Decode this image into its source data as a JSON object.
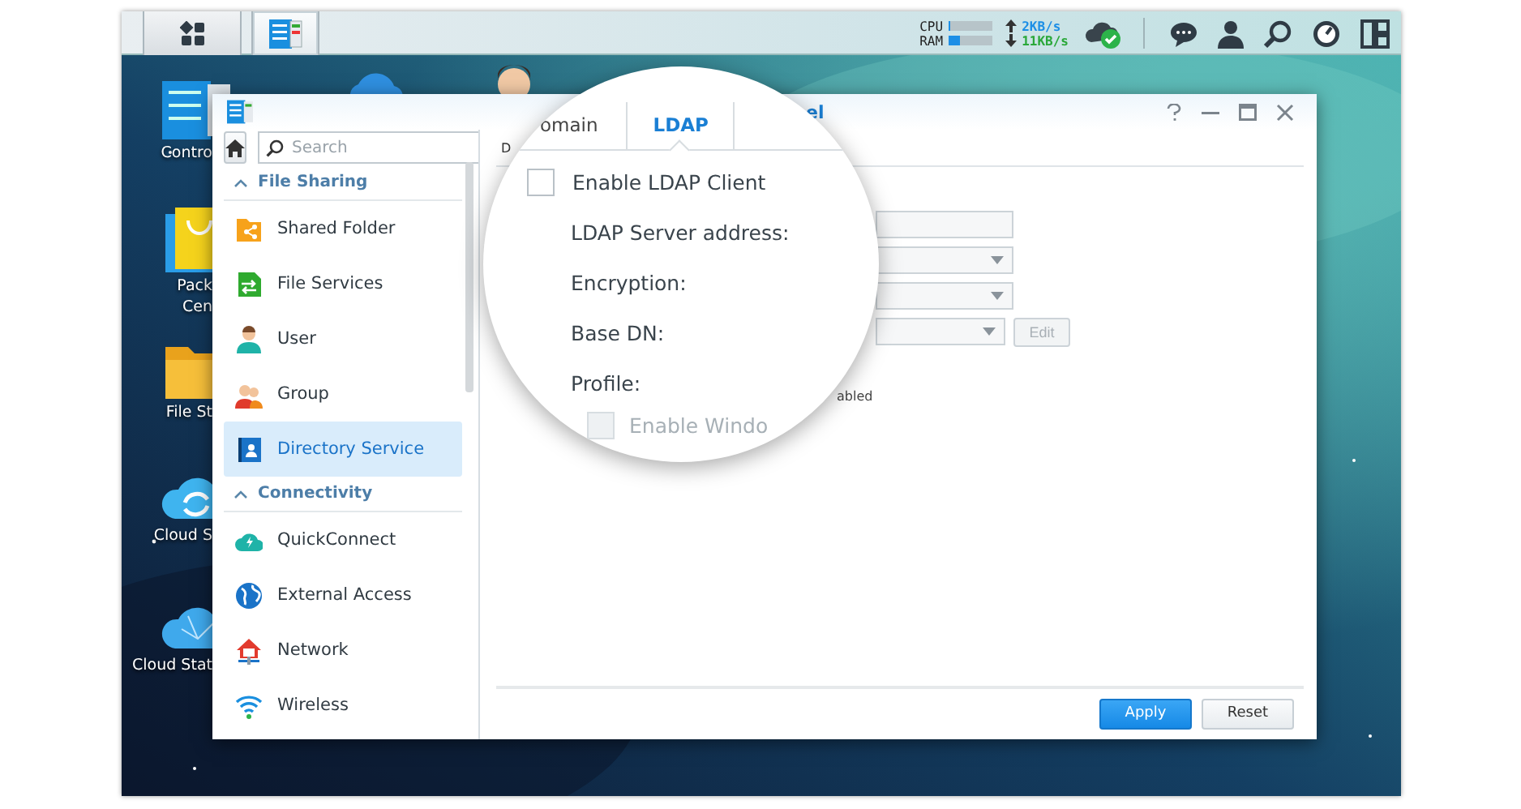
{
  "taskbar": {
    "apps": [
      {
        "selected": false
      },
      {
        "selected": true
      }
    ],
    "cpu": {
      "label": "CPU",
      "level": 0.03
    },
    "ram": {
      "label": "RAM",
      "level": 0.25
    },
    "upload": "2KB/s",
    "download": "11KB/s"
  },
  "desktop_icons": [
    {
      "lines": [
        "Contro"
      ]
    },
    {
      "lines": [
        "Pack",
        "Cen"
      ]
    },
    {
      "lines": [
        "File St"
      ]
    },
    {
      "lines": [
        "Cloud S"
      ]
    },
    {
      "lines": [
        "Cloud Stat"
      ]
    }
  ],
  "window": {
    "tab_fragment": "el",
    "sidebar": {
      "search": {
        "placeholder": "Search"
      },
      "sections": [
        {
          "title": "File Sharing",
          "expanded": true,
          "items": [
            {
              "label": "Shared Folder",
              "selected": false
            },
            {
              "label": "File Services",
              "selected": false
            },
            {
              "label": "User",
              "selected": false
            },
            {
              "label": "Group",
              "selected": false
            },
            {
              "label": "Directory Service",
              "selected": true
            }
          ]
        },
        {
          "title": "Connectivity",
          "expanded": true,
          "items": [
            {
              "label": "QuickConnect",
              "selected": false
            },
            {
              "label": "External Access",
              "selected": false
            },
            {
              "label": "Network",
              "selected": false
            },
            {
              "label": "Wireless",
              "selected": false
            }
          ]
        }
      ]
    },
    "content": {
      "header_fragment": "D",
      "fields": [
        {
          "kind": "text"
        },
        {
          "kind": "select"
        },
        {
          "kind": "select"
        },
        {
          "kind": "select"
        }
      ],
      "edit_button": {
        "label": "Edit",
        "disabled": true
      },
      "note_fragment": "abled",
      "buttons": [
        {
          "label": "Apply",
          "kind": "primary"
        },
        {
          "label": "Reset",
          "kind": "default"
        }
      ]
    },
    "magnifier": {
      "tabs": [
        {
          "label": "omain",
          "selected": false
        },
        {
          "label": "LDAP",
          "selected": true
        }
      ],
      "checkbox": {
        "label": "Enable LDAP Client",
        "checked": false
      },
      "labels": [
        "LDAP Server address:",
        "Encryption:",
        "Base DN:",
        "Profile:"
      ],
      "option": {
        "label": "Enable Windo",
        "checked": false,
        "disabled": true
      }
    }
  }
}
